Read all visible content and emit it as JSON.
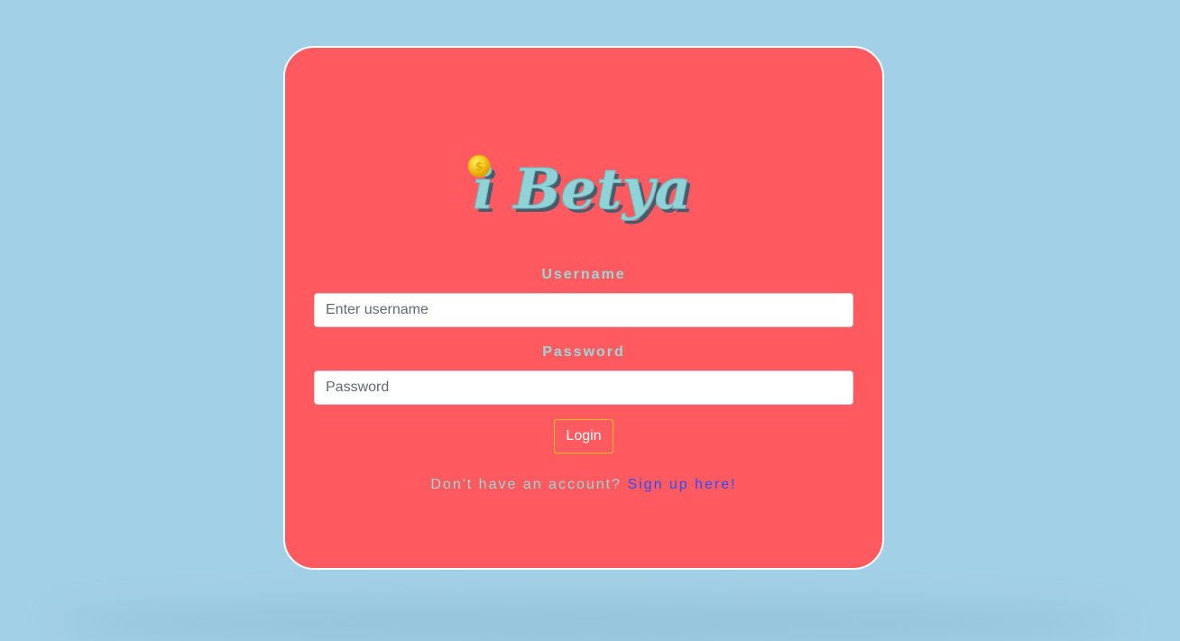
{
  "brand": {
    "logo_text": "i Betya",
    "coin_symbol": "$",
    "logo_color": "#8fd3d6",
    "coin_color": "#f3c317"
  },
  "form": {
    "username_label": "Username",
    "username_placeholder": "Enter username",
    "password_label": "Password",
    "password_placeholder": "Password",
    "login_label": "Login"
  },
  "signup": {
    "prompt": "Don't have an account? ",
    "link_label": "Sign up here!"
  },
  "colors": {
    "background": "#a2d0e6",
    "card": "#ff5a60",
    "label": "#99d6d6",
    "link": "#2f4cff",
    "button_border": "#f3c317"
  }
}
